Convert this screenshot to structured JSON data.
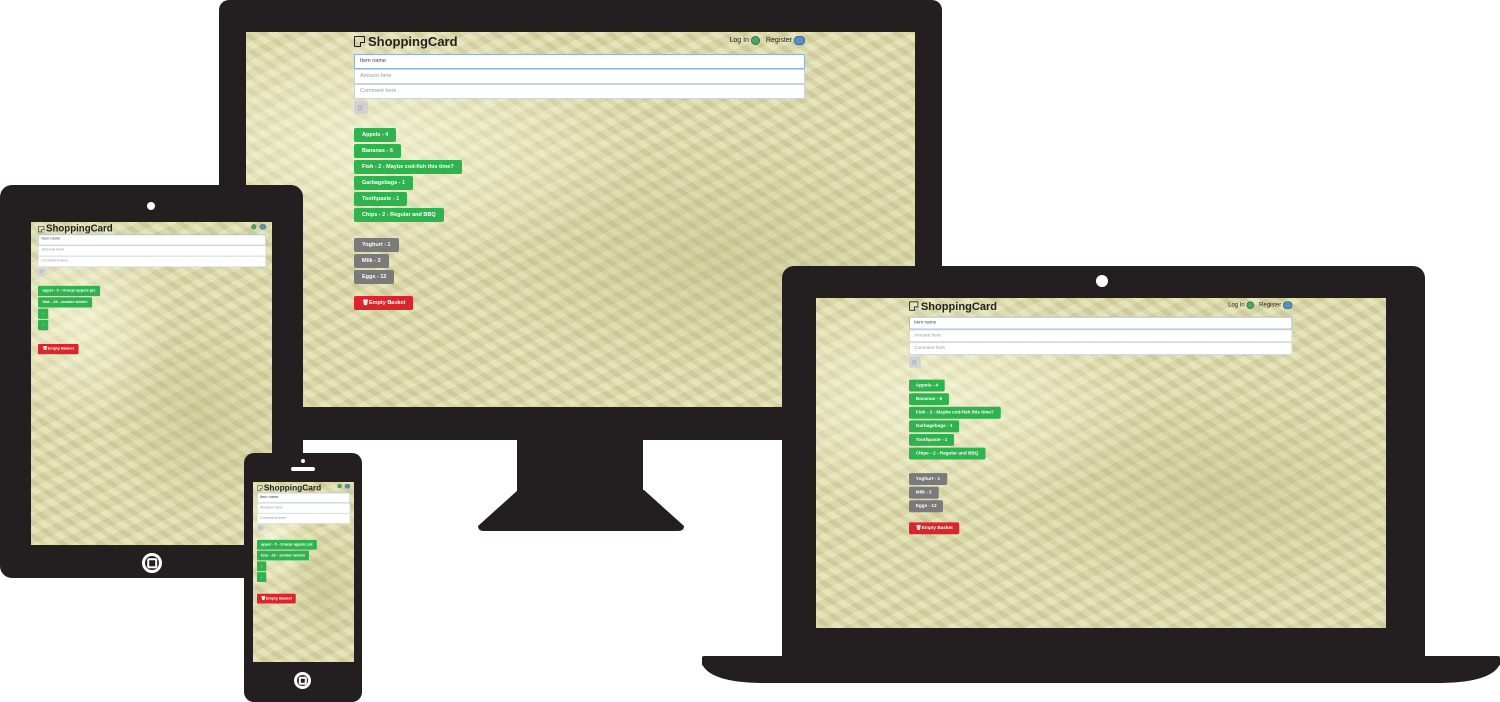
{
  "app": {
    "brand": "ShoppingCard",
    "nav": {
      "login_label": "Log In",
      "register_label": "Register"
    },
    "form": {
      "item_placeholder": "Item name",
      "amount_placeholder": "Amount here",
      "comment_placeholder": "Comment here"
    },
    "empty_button_label": "Empty Basket",
    "cart_icon": "cart-icon"
  },
  "desktop_list": {
    "pending": [
      "Appels - 4",
      "Bananas - 6",
      "Fish - 2 - Maybe cod-fish this time?",
      "Garbagebags - 1",
      "Toothpaste - 1",
      "Chips - 2 - Regular and BBQ"
    ],
    "done": [
      "Yoghurt - 1",
      "Milk - 2",
      "Eggs - 12"
    ]
  },
  "mobile_list": {
    "pending": [
      "appel - 5 - Oranje appels plz",
      "feta - 23 - zonder wielen",
      "-",
      "-"
    ]
  },
  "colors": {
    "green": "#2fb34e",
    "gray": "#7a7a7a",
    "red": "#d9262c",
    "device": "#231f20"
  }
}
